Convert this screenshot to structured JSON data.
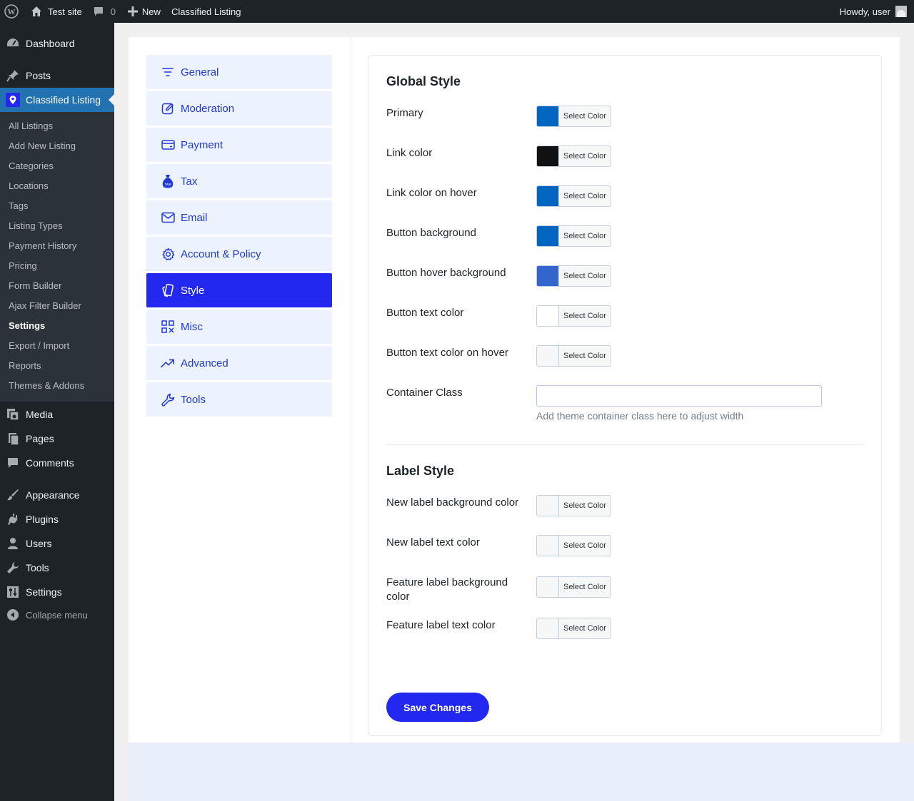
{
  "admin_bar": {
    "site_name": "Test site",
    "comments_count": "0",
    "new_label": "New",
    "plugin_link": "Classified Listing",
    "greeting": "Howdy, user"
  },
  "admin_menu": {
    "dashboard": "Dashboard",
    "posts": "Posts",
    "classified_listing": "Classified Listing",
    "submenu": [
      "All Listings",
      "Add New Listing",
      "Categories",
      "Locations",
      "Tags",
      "Listing Types",
      "Payment History",
      "Pricing",
      "Form Builder",
      "Ajax Filter Builder",
      "Settings",
      "Export / Import",
      "Reports",
      "Themes & Addons"
    ],
    "current_submenu": "Settings",
    "media": "Media",
    "pages": "Pages",
    "comments": "Comments",
    "appearance": "Appearance",
    "plugins": "Plugins",
    "users": "Users",
    "tools": "Tools",
    "settings": "Settings",
    "collapse": "Collapse menu"
  },
  "tabs": {
    "general": "General",
    "moderation": "Moderation",
    "payment": "Payment",
    "tax": "Tax",
    "email": "Email",
    "account_policy": "Account & Policy",
    "style": "Style",
    "misc": "Misc",
    "advanced": "Advanced",
    "tools": "Tools",
    "active": "Style",
    "tax_icon_text": "TAX"
  },
  "global_style": {
    "title": "Global Style",
    "select_label": "Select Color",
    "fields": [
      {
        "label": "Primary",
        "color": "#0066bf"
      },
      {
        "label": "Link color",
        "color": "#111111"
      },
      {
        "label": "Link color on hover",
        "color": "#0066bf"
      },
      {
        "label": "Button background",
        "color": "#0066bf"
      },
      {
        "label": "Button hover background",
        "color": "#3366cc"
      },
      {
        "label": "Button text color",
        "color": "#ffffff"
      },
      {
        "label": "Button text color on hover",
        "color": "#f6f7f7"
      }
    ],
    "container_class_label": "Container Class",
    "container_class_value": "",
    "container_class_help": "Add theme container class here to adjust width"
  },
  "label_style": {
    "title": "Label Style",
    "fields": [
      {
        "label": "New label background color",
        "color": "#f6f7f7"
      },
      {
        "label": "New label text color",
        "color": "#f6f7f7"
      },
      {
        "label": "Feature label background color",
        "color": "#f6f7f7"
      },
      {
        "label": "Feature label text color",
        "color": "#f6f7f7"
      }
    ]
  },
  "save_button": "Save Changes",
  "colors": {
    "accent": "#2328f0",
    "wp_blue": "#2271b1",
    "admin_dark": "#1d2327",
    "tab_bg": "#ecf3fe",
    "tab_text": "#2239d5"
  }
}
